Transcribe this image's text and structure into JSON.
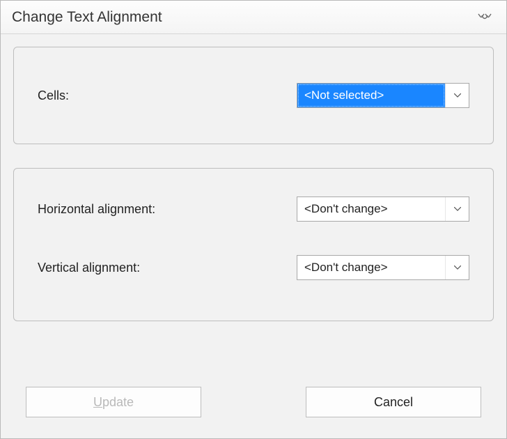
{
  "window": {
    "title": "Change Text Alignment"
  },
  "group_cells": {
    "cells_label": "Cells:",
    "cells_value": "<Not selected>"
  },
  "group_align": {
    "horizontal_label": "Horizontal alignment:",
    "horizontal_value": "<Don't change>",
    "vertical_label": "Vertical alignment:",
    "vertical_value": "<Don't change>"
  },
  "buttons": {
    "update_prefix": "U",
    "update_rest": "pdate",
    "update_enabled": false,
    "cancel_label": "Cancel"
  },
  "icons": {
    "close": "close-icon",
    "dropdown": "chevron-down-icon"
  }
}
